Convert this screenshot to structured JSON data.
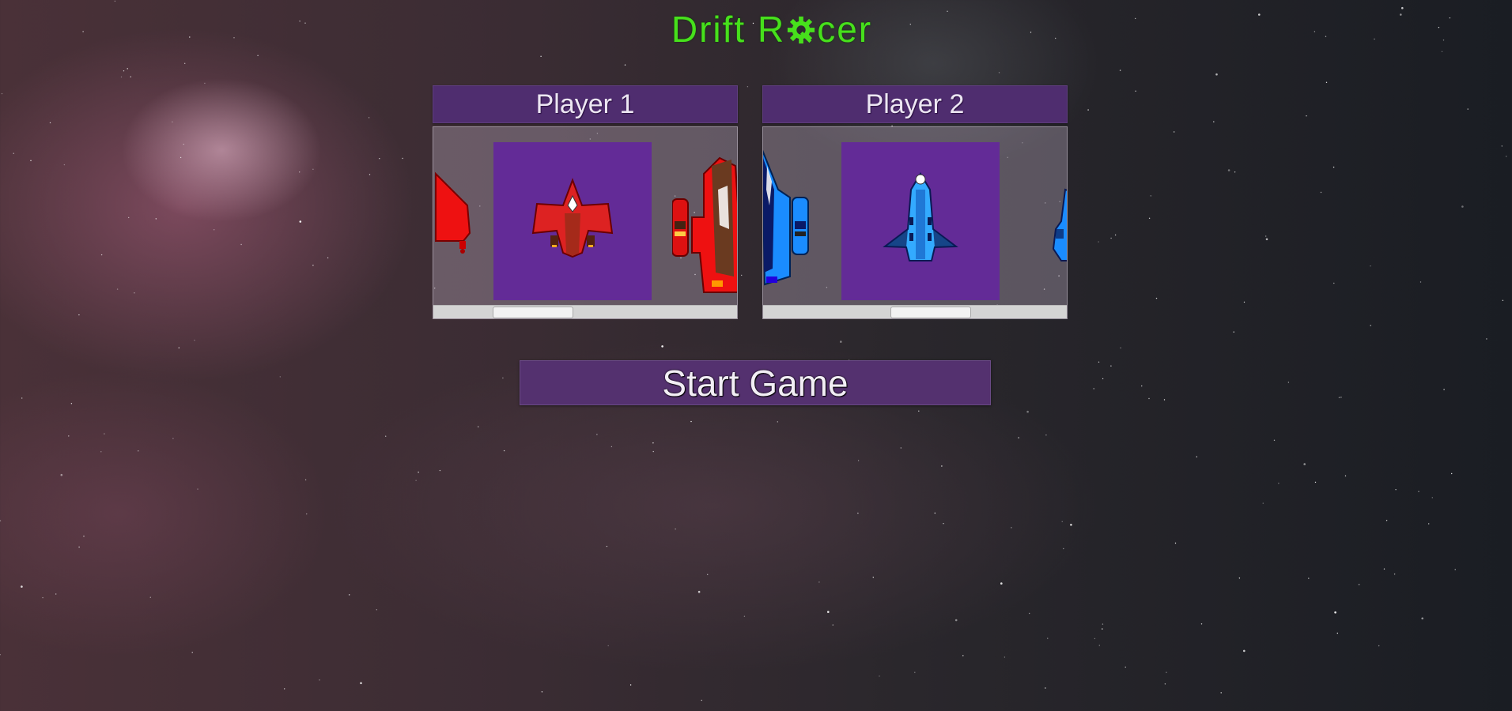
{
  "game": {
    "title_part1": "Drift R",
    "title_part2": "cer",
    "title_icon": "gear-wrench-icon",
    "title_color": "#47e01c"
  },
  "players": [
    {
      "label": "Player 1",
      "ship_color": "red",
      "selected_index": 1,
      "carousel_scroll_fraction": 0.22,
      "ships": [
        "red-ship-partial",
        "red-ship-selected",
        "red-ship-large"
      ]
    },
    {
      "label": "Player 2",
      "ship_color": "blue",
      "selected_index": 1,
      "carousel_scroll_fraction": 0.48,
      "ships": [
        "blue-ship-partial",
        "blue-ship-selected",
        "blue-ship-partial-right"
      ]
    }
  ],
  "start_button": {
    "label": "Start Game"
  },
  "colors": {
    "panel_header": "#4f2d6f",
    "selected_slot": "#632b97",
    "button": "#54316f"
  }
}
